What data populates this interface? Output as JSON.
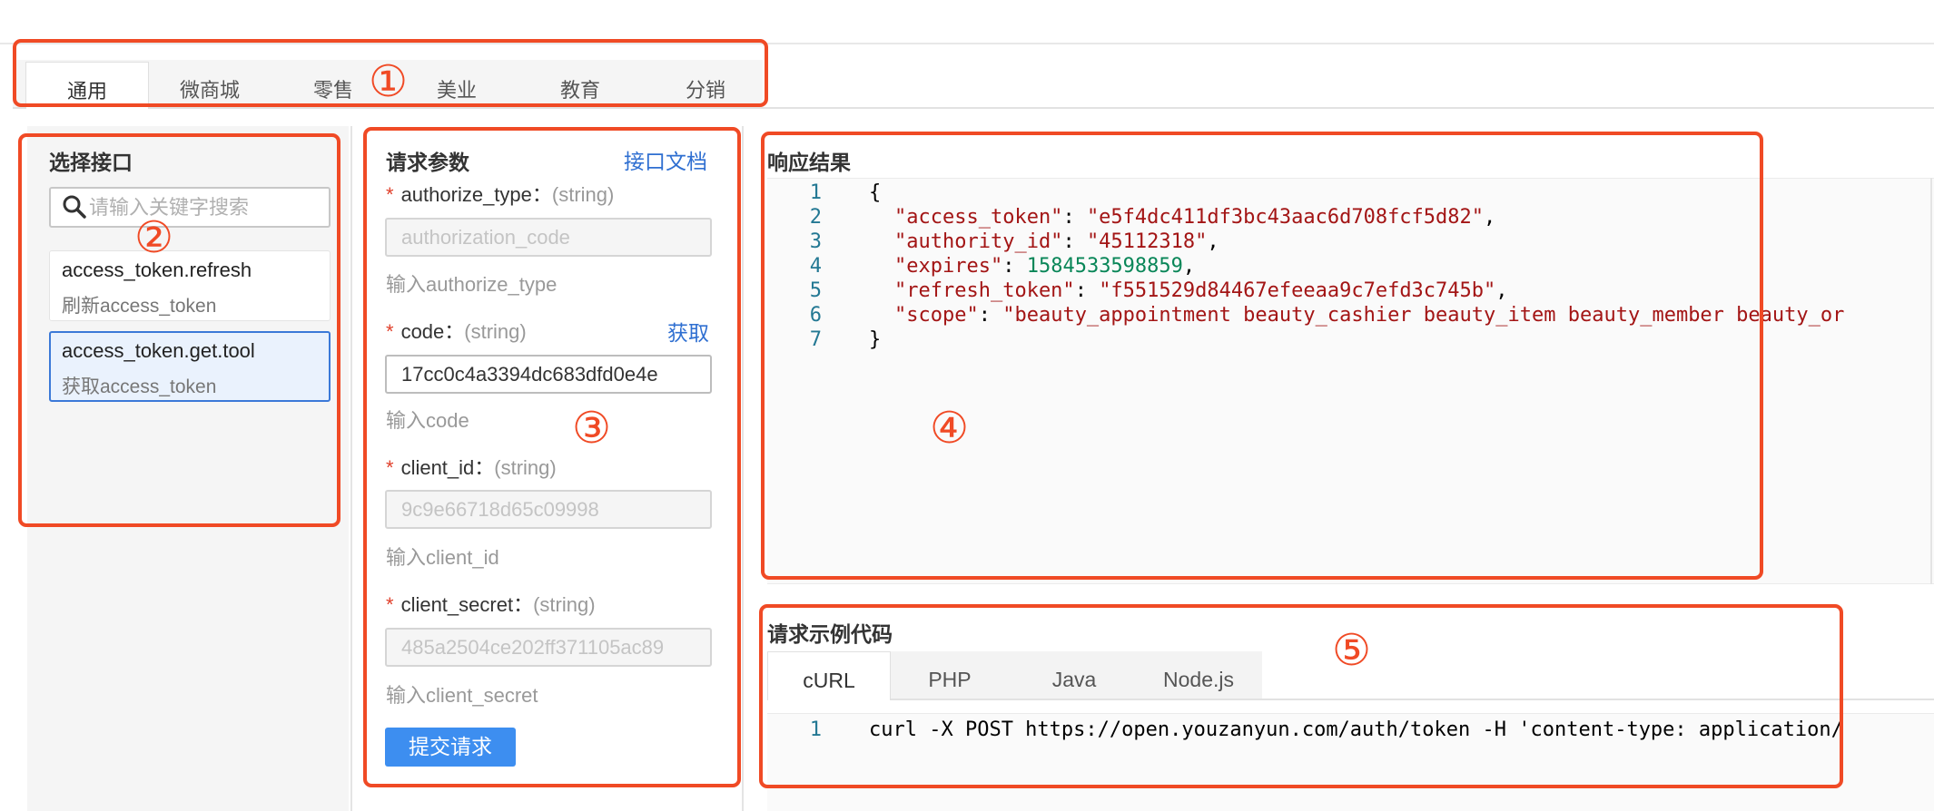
{
  "tabs": [
    {
      "label": "通用",
      "active": true
    },
    {
      "label": "微商城",
      "active": false
    },
    {
      "label": "零售",
      "active": false
    },
    {
      "label": "美业",
      "active": false
    },
    {
      "label": "教育",
      "active": false
    },
    {
      "label": "分销",
      "active": false
    }
  ],
  "sidebar": {
    "title": "选择接口",
    "search_placeholder": "请输入关键字搜索",
    "search_icon": "search-icon",
    "items": [
      {
        "name": "access_token.refresh",
        "desc": "刷新access_token",
        "selected": false
      },
      {
        "name": "access_token.get.tool",
        "desc": "获取access_token",
        "selected": true
      }
    ]
  },
  "request": {
    "title": "请求参数",
    "doc_link": "接口文档",
    "fetch_link": "获取",
    "submit_label": "提交请求",
    "required_mark": "*",
    "fields": [
      {
        "name": "authorize_type：",
        "type": "(string)",
        "value": "authorization_code",
        "hint": "输入authorize_type",
        "disabled": true
      },
      {
        "name": "code：",
        "type": "(string)",
        "value": "17cc0c4a3394dc683dfd0e4e",
        "hint": "输入code",
        "disabled": false
      },
      {
        "name": "client_id：",
        "type": "(string)",
        "value": "9c9e66718d65c09998",
        "hint": "输入client_id",
        "disabled": true
      },
      {
        "name": "client_secret：",
        "type": "(string)",
        "value": "485a2504ce202ff371105ac89",
        "hint": "输入client_secret",
        "disabled": true
      }
    ]
  },
  "response": {
    "title": "响应结果",
    "line_numbers": [
      "1",
      "2",
      "3",
      "4",
      "5",
      "6",
      "7"
    ],
    "open_brace": "{",
    "close_brace": "}",
    "entries": [
      {
        "key": "\"access_token\"",
        "value": "\"e5f4dc411df3bc43aac6d708fcf5d82\"",
        "value_type": "string",
        "trail": ","
      },
      {
        "key": "\"authority_id\"",
        "value": "\"45112318\"",
        "value_type": "string",
        "trail": ","
      },
      {
        "key": "\"expires\"",
        "value": "1584533598859",
        "value_type": "number",
        "trail": ","
      },
      {
        "key": "\"refresh_token\"",
        "value": "\"f551529d84467efeeaa9c7efd3c745b\"",
        "value_type": "string",
        "trail": ","
      },
      {
        "key": "\"scope\"",
        "value": "\"beauty_appointment beauty_cashier beauty_item beauty_member beauty_or",
        "value_type": "string",
        "trail": ""
      }
    ]
  },
  "sample": {
    "title": "请求示例代码",
    "tabs": [
      {
        "label": "cURL",
        "active": true
      },
      {
        "label": "PHP",
        "active": false
      },
      {
        "label": "Java",
        "active": false
      },
      {
        "label": "Node.js",
        "active": false
      }
    ],
    "line_number": "1",
    "code": "curl -X POST https://open.youzanyun.com/auth/token -H 'content-type: application/"
  },
  "annotations": [
    "①",
    "②",
    "③",
    "④",
    "⑤"
  ],
  "colors": {
    "annotation": "#f04a25",
    "link": "#2f6fd1",
    "primary_button": "#3d8ef0",
    "selected_item_border": "#3b79d8",
    "required_star": "#e0412c",
    "json_key": "#a31515",
    "json_number": "#098658",
    "line_number": "#237893"
  }
}
